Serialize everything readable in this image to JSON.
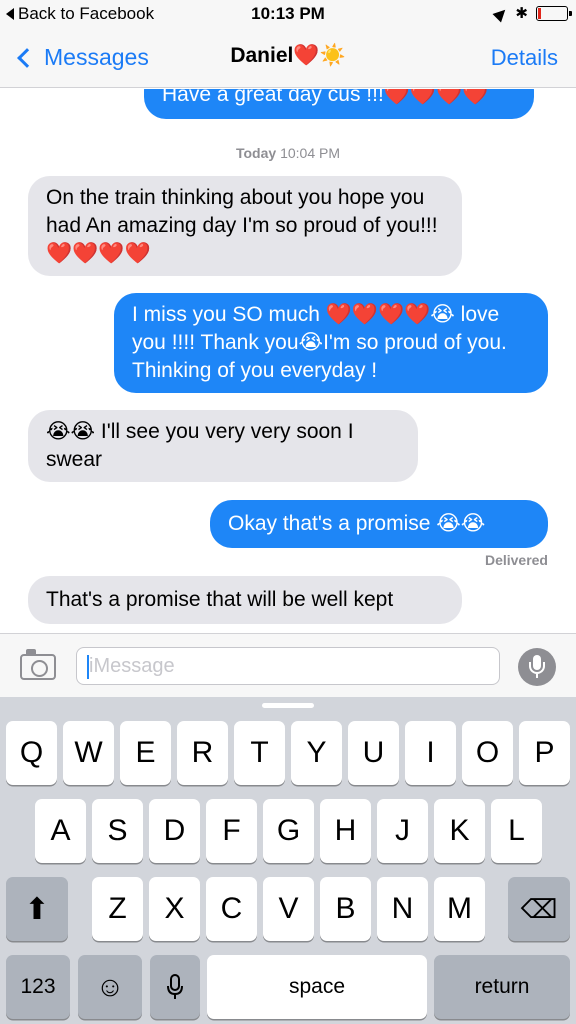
{
  "status_bar": {
    "back_label": "Back to Facebook",
    "time": "10:13 PM",
    "bluetooth": "✱"
  },
  "nav": {
    "back_label": "Messages",
    "title": "Daniel❤️☀️",
    "details_label": "Details"
  },
  "conversation": {
    "messages": [
      {
        "direction": "out",
        "text": "Have a great day cus !!!❤️❤️❤️❤️"
      },
      {
        "direction": "in",
        "text": "On the train thinking about you hope you had An amazing day I'm so proud of you!!! ❤️❤️❤️❤️"
      },
      {
        "direction": "out",
        "text": "I miss you SO much ❤️❤️❤️❤️😭 love you !!!! Thank you😭I'm so proud of you. Thinking of you everyday !"
      },
      {
        "direction": "in",
        "text": "😭😭 I'll see you very very soon I swear"
      },
      {
        "direction": "out",
        "text": "Okay that's a promise 😭😭"
      },
      {
        "direction": "in",
        "text": "That's a promise that will be well kept"
      }
    ],
    "timestamp_day": "Today",
    "timestamp_time": " 10:04 PM",
    "delivered": "Delivered"
  },
  "input": {
    "placeholder": "iMessage"
  },
  "keyboard": {
    "row1": [
      "Q",
      "W",
      "E",
      "R",
      "T",
      "Y",
      "U",
      "I",
      "O",
      "P"
    ],
    "row2": [
      "A",
      "S",
      "D",
      "F",
      "G",
      "H",
      "J",
      "K",
      "L"
    ],
    "row3": [
      "Z",
      "X",
      "C",
      "V",
      "B",
      "N",
      "M"
    ],
    "numbers": "123",
    "emoji": "☺",
    "space": "space",
    "return": "return",
    "shift": "⬆",
    "backspace": "⌫"
  },
  "colors": {
    "accent": "#1b7bf6",
    "outgoing_bubble": "#1e86f7",
    "incoming_bubble": "#e5e5ea",
    "keyboard_bg": "#d2d5db"
  }
}
